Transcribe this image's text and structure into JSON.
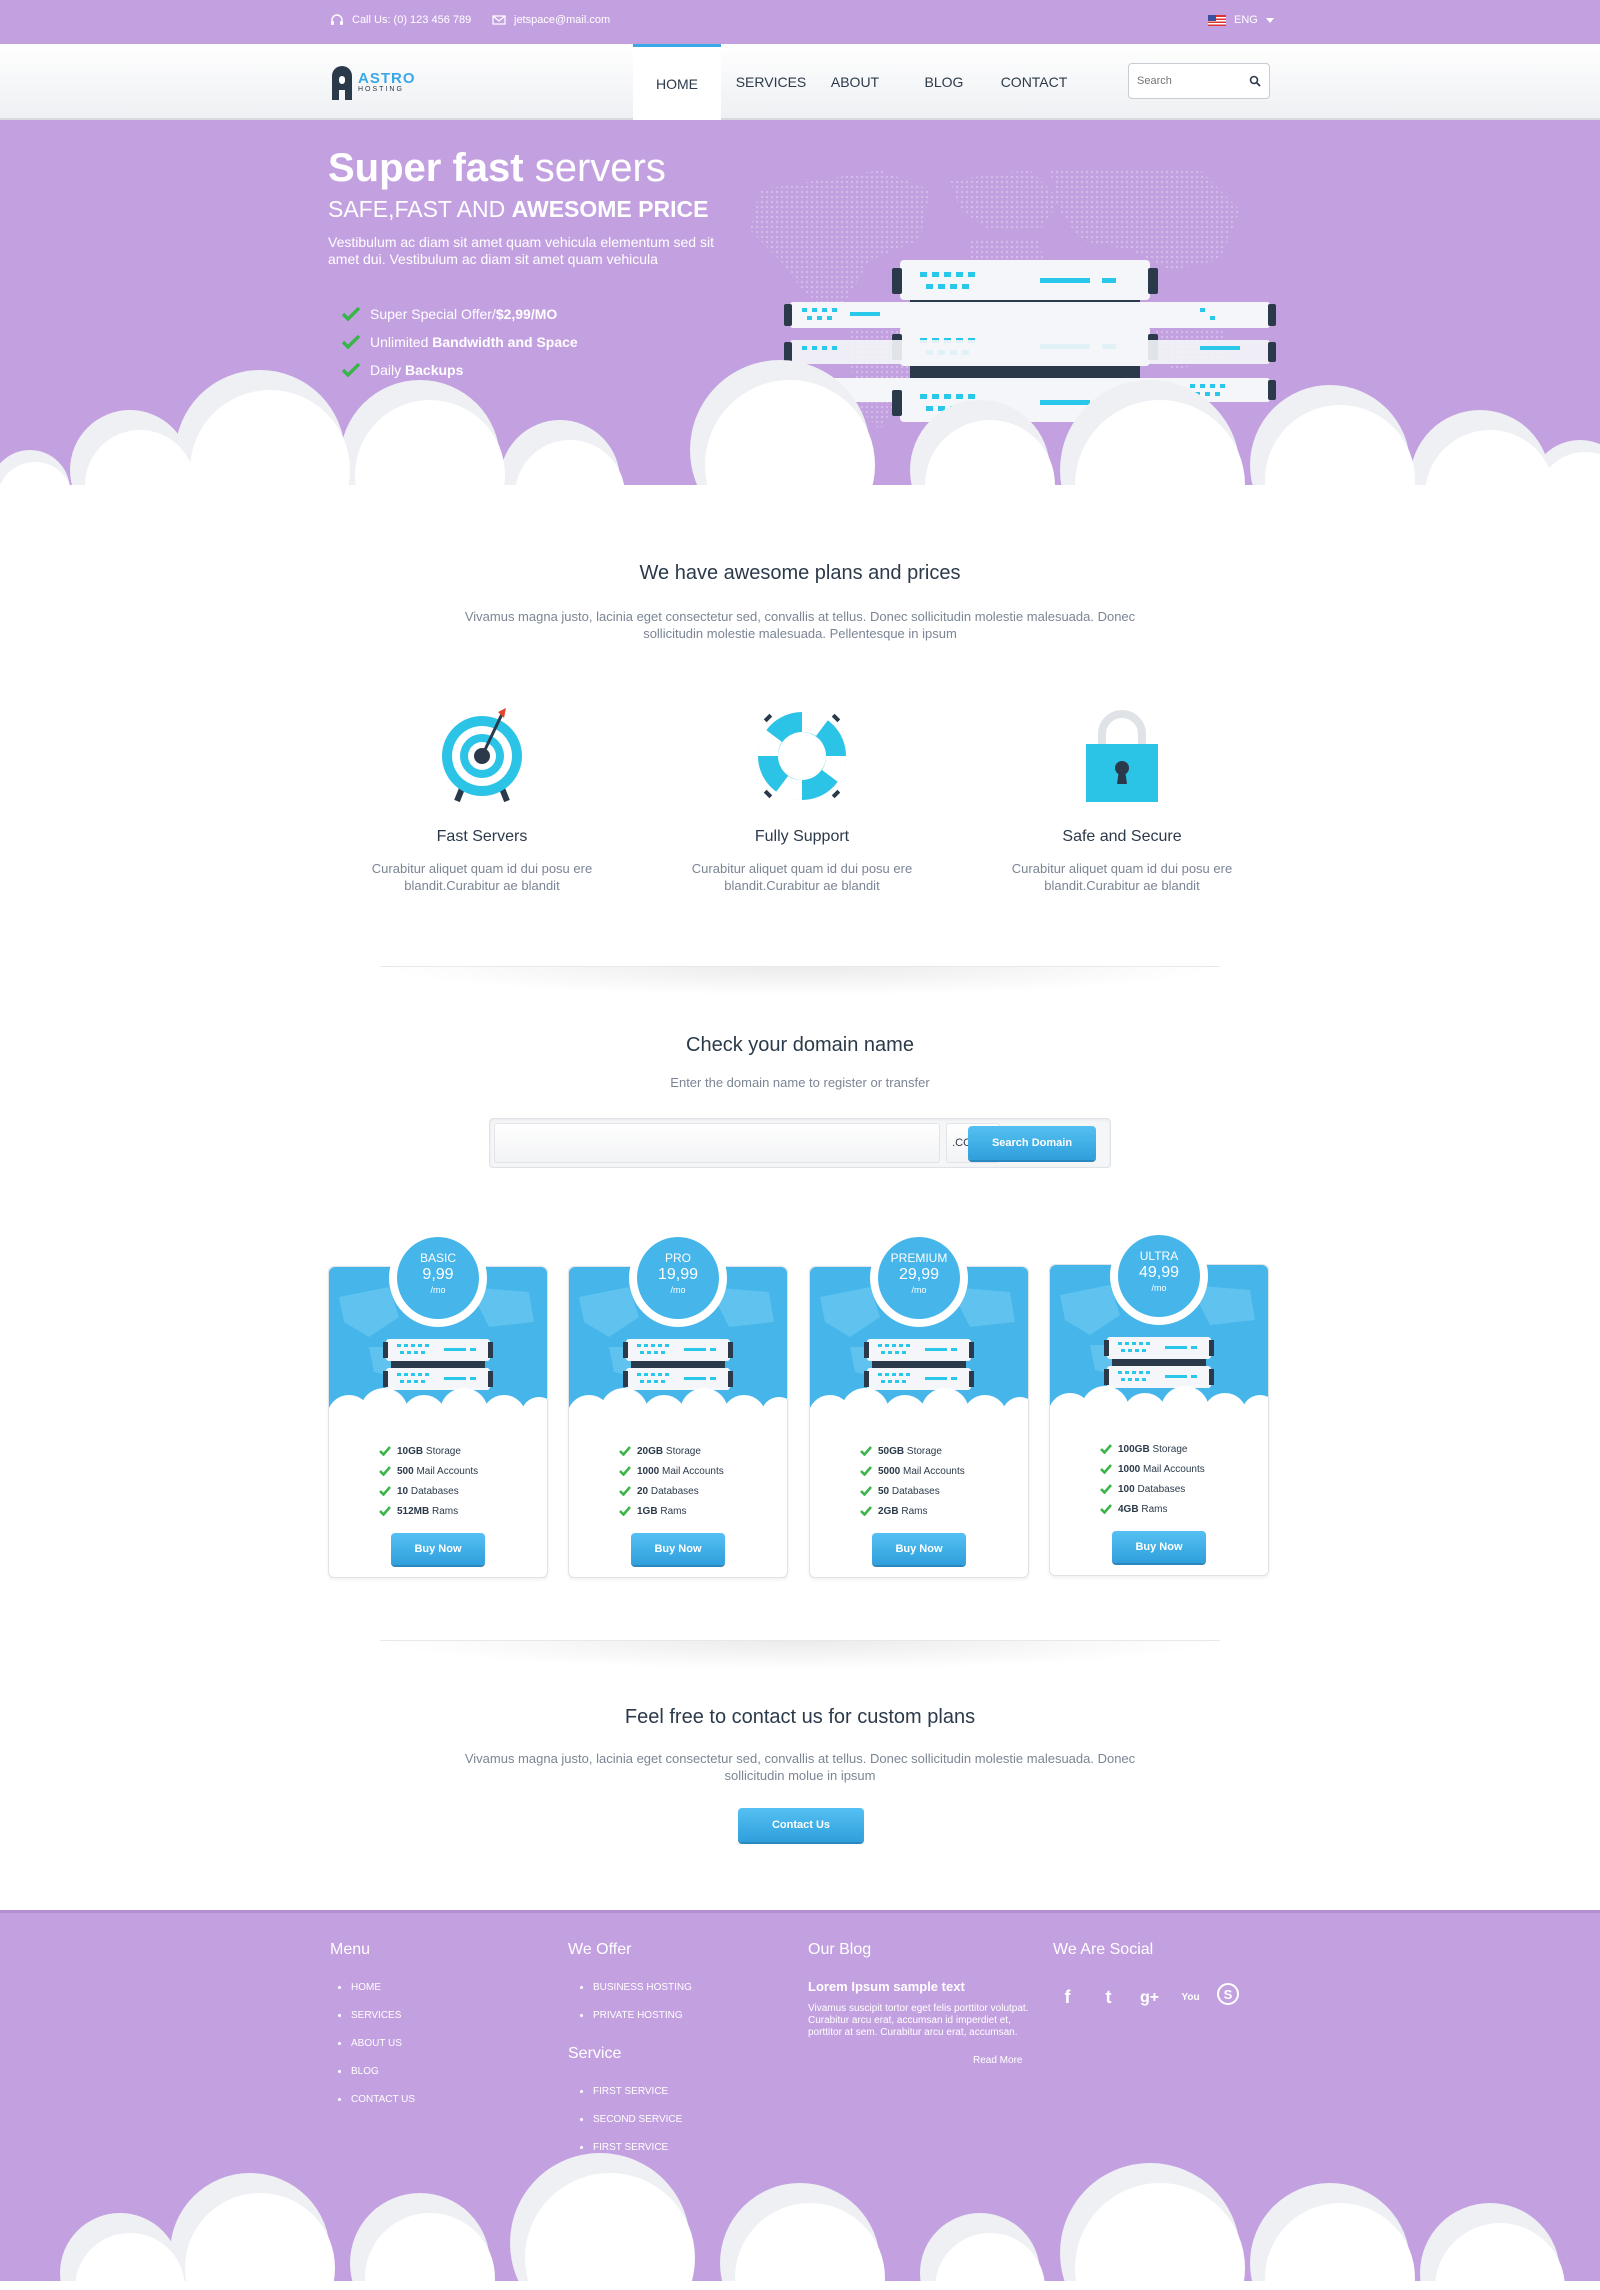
{
  "topbar": {
    "phone": "Call Us: (0) 123 456 789",
    "email": "jetspace@mail.com",
    "language": "ENG"
  },
  "logo": {
    "line1": "ASTRO",
    "line2": "HOSTING"
  },
  "nav": {
    "items": [
      {
        "label": "HOME"
      },
      {
        "label": "SERVICES"
      },
      {
        "label": "ABOUT"
      },
      {
        "label": "BLOG"
      },
      {
        "label": "CONTACT"
      }
    ],
    "search_placeholder": "Search"
  },
  "hero": {
    "title_bold": "Super fast",
    "title_rest": " servers",
    "subtitle_plain": "SAFE,FAST AND ",
    "subtitle_bold": "AWESOME PRICE",
    "description": "Vestibulum ac diam sit amet quam vehicula elementum sed sit amet dui. Vestibulum ac diam sit amet quam vehicula",
    "list": [
      {
        "plain": "Super Special Offer/",
        "bold": "$2,99/MO"
      },
      {
        "plain": "Unlimited ",
        "bold": "Bandwidth and Space"
      },
      {
        "plain": "Daily ",
        "bold": "Backups"
      }
    ]
  },
  "plans_intro": {
    "title": "We have awesome plans and prices",
    "text": "Vivamus magna justo, lacinia eget consectetur sed, convallis at tellus. Donec sollicitudin molestie malesuada. Donec sollicitudin molestie malesuada. Pellentesque in ipsum"
  },
  "features": [
    {
      "icon": "target-icon",
      "title": "Fast Servers",
      "text": "Curabitur aliquet quam id dui posu ere blandit.Curabitur ae blandit"
    },
    {
      "icon": "lifebuoy-icon",
      "title": "Fully Support",
      "text": "Curabitur aliquet quam id dui posu ere blandit.Curabitur ae blandit"
    },
    {
      "icon": "padlock-icon",
      "title": "Safe and Secure",
      "text": "Curabitur aliquet quam id dui posu ere blandit.Curabitur ae blandit"
    }
  ],
  "domain": {
    "title": "Check your domain name",
    "subtitle": "Enter the domain name to register or transfer",
    "tld": ".COM",
    "button": "Search Domain"
  },
  "plans": [
    {
      "name": "BASIC",
      "price": "9,99",
      "period": "/mo",
      "features": [
        {
          "b": "10GB",
          "t": " Storage"
        },
        {
          "b": "500",
          "t": " Mail Accounts"
        },
        {
          "b": "10",
          "t": " Databases"
        },
        {
          "b": "512MB",
          "t": " Rams"
        }
      ],
      "button": "Buy Now"
    },
    {
      "name": "PRO",
      "price": "19,99",
      "period": "/mo",
      "features": [
        {
          "b": "20GB",
          "t": " Storage"
        },
        {
          "b": "1000",
          "t": " Mail Accounts"
        },
        {
          "b": "20",
          "t": " Databases"
        },
        {
          "b": "1GB",
          "t": " Rams"
        }
      ],
      "button": "Buy Now"
    },
    {
      "name": "PREMIUM",
      "price": "29,99",
      "period": "/mo",
      "features": [
        {
          "b": "50GB",
          "t": " Storage"
        },
        {
          "b": "5000",
          "t": " Mail Accounts"
        },
        {
          "b": "50",
          "t": " Databases"
        },
        {
          "b": "2GB",
          "t": " Rams"
        }
      ],
      "button": "Buy Now"
    },
    {
      "name": "ULTRA",
      "price": "49,99",
      "period": "/mo",
      "features": [
        {
          "b": "100GB",
          "t": " Storage"
        },
        {
          "b": "1000",
          "t": " Mail Accounts"
        },
        {
          "b": "100",
          "t": " Databases"
        },
        {
          "b": "4GB",
          "t": " Rams"
        }
      ],
      "button": "Buy Now"
    }
  ],
  "custom": {
    "title": "Feel free to contact us for custom plans",
    "text": "Vivamus magna justo, lacinia eget consectetur sed, convallis at tellus. Donec sollicitudin molestie malesuada. Donec sollicitudin molue in ipsum",
    "button": "Contact Us"
  },
  "footer": {
    "menu_title": "Menu",
    "menu": [
      "HOME",
      "SERVICES",
      "ABOUT US",
      "BLOG",
      "CONTACT US"
    ],
    "offer_title": "We Offer",
    "offer": [
      "BUSINESS HOSTING",
      "PRIVATE HOSTING"
    ],
    "service_title": "Service",
    "service": [
      "FIRST SERVICE",
      "SECOND SERVICE",
      "FIRST SERVICE"
    ],
    "blog_title": "Our Blog",
    "blog_post_title": "Lorem Ipsum sample text",
    "blog_post_text": "Vivamus suscipit tortor eget felis porttitor volutpat. Curabitur arcu erat, accumsan id imperdiet et, porttitor at sem. Curabitur arcu erat, accumsan.",
    "blog_more": "Read More",
    "social_title": "We Are Social",
    "social": [
      {
        "icon": "facebook-icon",
        "glyph": "f"
      },
      {
        "icon": "twitter-icon",
        "glyph": "t"
      },
      {
        "icon": "google-plus-icon",
        "glyph": "g+"
      },
      {
        "icon": "youtube-icon",
        "glyph": "You"
      },
      {
        "icon": "skype-icon",
        "glyph": "S"
      }
    ]
  },
  "colors": {
    "purple": "#c3a1e0",
    "accent_blue": "#45b5ea",
    "dark": "#2b3a4a",
    "check_green": "#3bb54a"
  }
}
